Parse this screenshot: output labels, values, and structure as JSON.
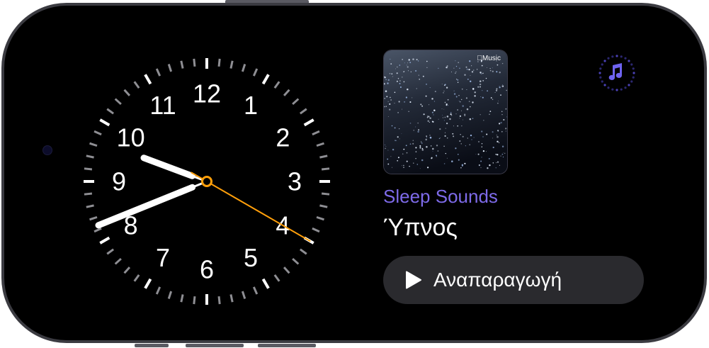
{
  "clock": {
    "numbers": [
      "12",
      "1",
      "2",
      "3",
      "4",
      "5",
      "6",
      "7",
      "8",
      "9",
      "10",
      "11"
    ],
    "time": {
      "hours": 9,
      "minutes": 41,
      "seconds": 20
    },
    "second_hand_color": "#ff9f0a"
  },
  "album": {
    "badge_label": "Music",
    "badge_icon": "apple-logo-icon"
  },
  "now_playing": {
    "title": "Sleep Sounds",
    "subtitle": "Ύπνος",
    "title_color": "#7d6ae8"
  },
  "app_icon": {
    "name": "music-note-icon",
    "color": "#6e63f0"
  },
  "play_button": {
    "label": "Αναπαραγωγή",
    "icon": "play-icon"
  }
}
